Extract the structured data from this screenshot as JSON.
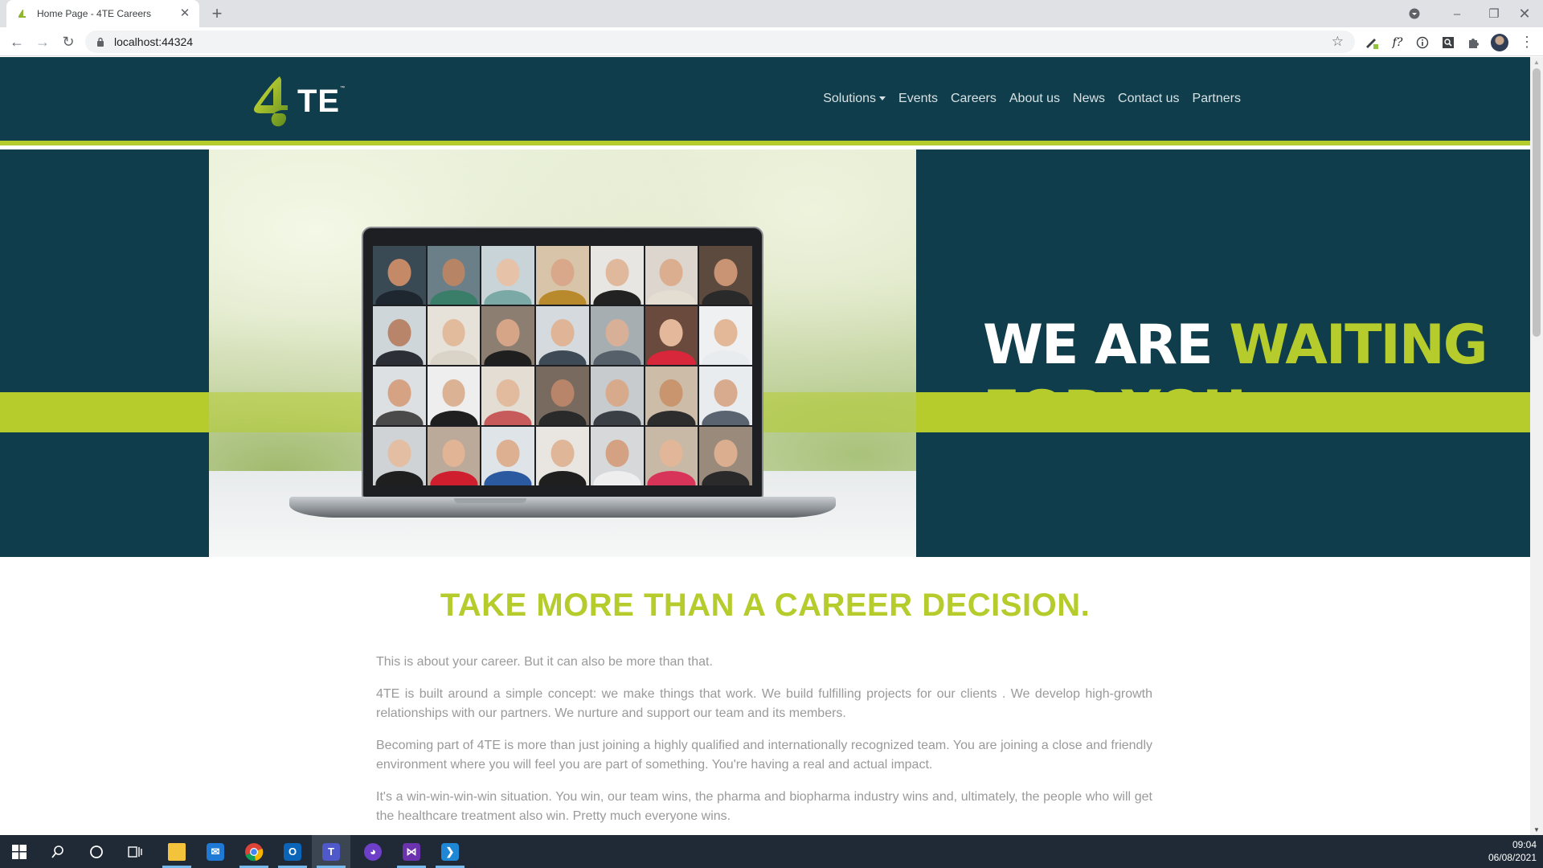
{
  "browser": {
    "tab_title": "Home Page - 4TE Careers",
    "url": "localhost:44324"
  },
  "site": {
    "logo_text": "TE",
    "logo_digit": "4",
    "nav": [
      {
        "label": "Solutions",
        "has_dropdown": true
      },
      {
        "label": "Events"
      },
      {
        "label": "Careers"
      },
      {
        "label": "About us"
      },
      {
        "label": "News"
      },
      {
        "label": "Contact us"
      },
      {
        "label": "Partners"
      }
    ],
    "hero": {
      "line1_white": "WE ARE ",
      "line1_lime": "WAITING",
      "line2_lime": "FOR YOU"
    },
    "section_title": "TAKE MORE THAN A CAREER DECISION.",
    "paragraphs": [
      "This is about your career. But it can also be more than that.",
      "4TE is built around a simple concept: we make things that work. We build fulfilling projects for our clients . We develop high-growth relationships with our partners. We nurture and support our team and its members.",
      "Becoming part of 4TE is more than just joining a highly qualified and internationally recognized team. You are joining a close and friendly environment where you will feel you are part of something. You're having a real and actual impact.",
      "It's a win-win-win-win situation. You win, our team wins, the pharma and biopharma industry wins and, ultimately, the people who will get the healthcare treatment also win. Pretty much everyone wins."
    ]
  },
  "colors": {
    "brand_teal": "#0f3d4b",
    "brand_lime": "#b5cc2c"
  },
  "taskbar": {
    "items": [
      "windows-start",
      "search",
      "cortana",
      "task-view",
      "file-explorer",
      "mail",
      "chrome",
      "outlook",
      "teams",
      "github-desktop",
      "visual-studio",
      "vs-code"
    ],
    "time": "09:04",
    "date": "06/08/2021"
  }
}
